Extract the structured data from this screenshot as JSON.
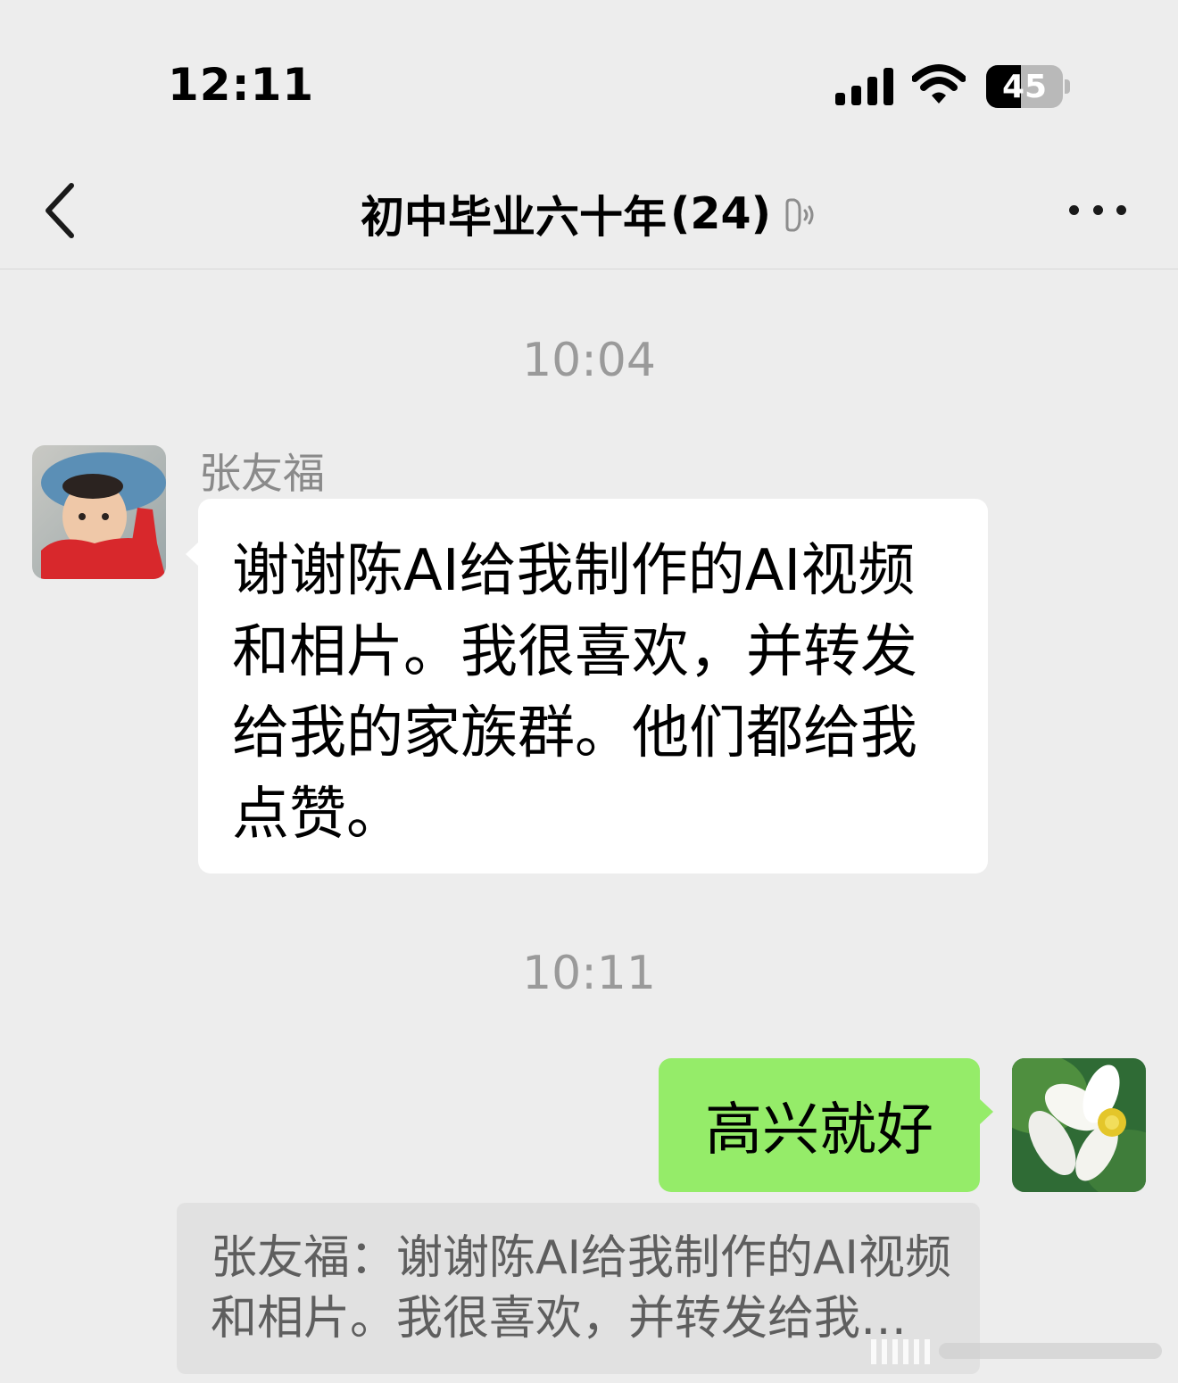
{
  "status_bar": {
    "time": "12:11",
    "battery_level": "45",
    "battery_fraction": 0.45
  },
  "nav": {
    "title": "初中毕业六十年",
    "member_count": "(24)"
  },
  "messages": [
    {
      "type": "timestamp",
      "text": "10:04"
    },
    {
      "type": "incoming",
      "sender": "张友福",
      "text": "谢谢陈AI给我制作的AI视频和相片。我很喜欢，并转发给我的家族群。他们都给我点赞。"
    },
    {
      "type": "timestamp",
      "text": "10:11"
    },
    {
      "type": "outgoing",
      "text": "高兴就好"
    }
  ],
  "quote": {
    "text": "张友福：谢谢陈AI给我制作的AI视频和相片。我很喜欢，并转发给我的家族群。他们都给我点赞。"
  },
  "icons": {
    "back": "chevron-left-icon",
    "mute": "mute-bell-icon",
    "more": "more-dots-icon",
    "signal": "cellular-signal-icon",
    "wifi": "wifi-icon",
    "battery": "battery-icon"
  },
  "colors": {
    "background": "#ededed",
    "incoming_bubble": "#ffffff",
    "outgoing_bubble": "#95ec69",
    "quote_background": "#e1e1e1"
  }
}
